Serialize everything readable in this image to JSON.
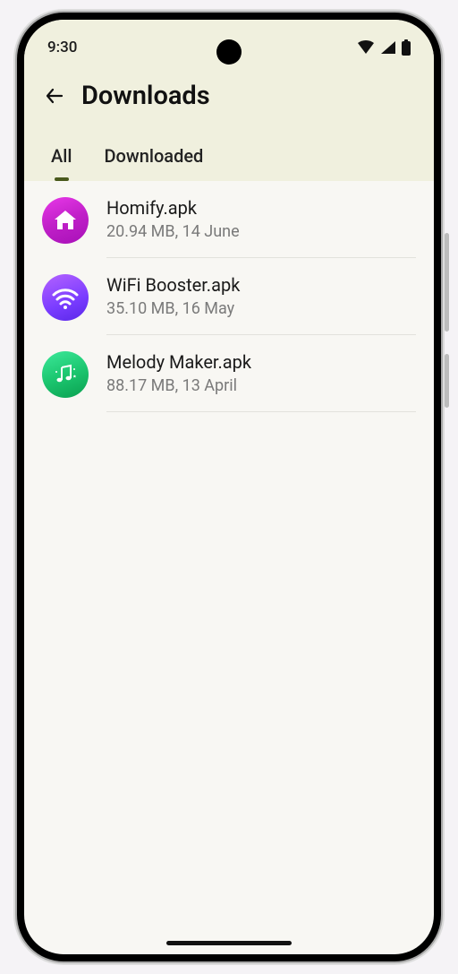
{
  "status": {
    "time": "9:30"
  },
  "header": {
    "title": "Downloads"
  },
  "tabs": {
    "all": "All",
    "downloaded": "Downloaded",
    "active": "all"
  },
  "items": [
    {
      "name": "Homify.apk",
      "meta": "20.94 MB, 14 June",
      "icon": "home-icon"
    },
    {
      "name": "WiFi Booster.apk",
      "meta": "35.10 MB, 16 May",
      "icon": "wifi-icon"
    },
    {
      "name": "Melody Maker.apk",
      "meta": "88.17 MB, 13 April",
      "icon": "music-icon"
    }
  ]
}
